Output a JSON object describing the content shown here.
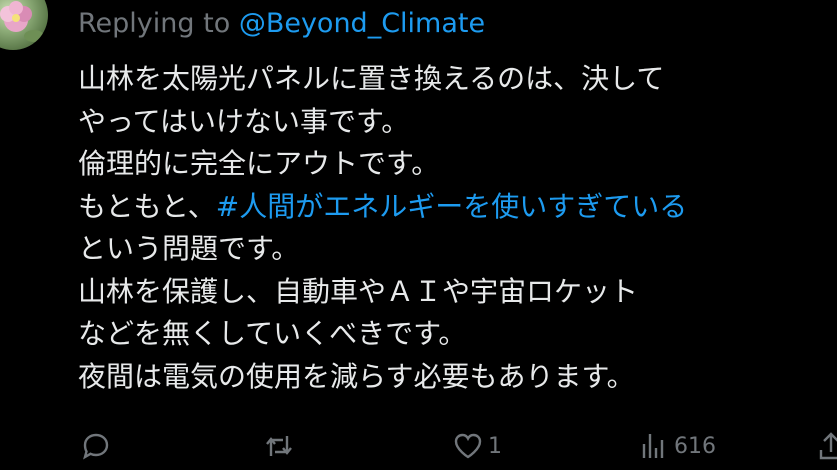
{
  "reply": {
    "prefix": "Replying to ",
    "handle": "@Beyond_Climate"
  },
  "tweet": {
    "line1": "山林を太陽光パネルに置き換えるのは、決して",
    "line2": "やってはいけない事です。",
    "line3": "倫理的に完全にアウトです。",
    "line4_prefix": "もともと、",
    "line4_hashtag": "#人間がエネルギーを使いすぎている",
    "line5": "という問題です。",
    "line6": "山林を保護し、自動車やＡＩや宇宙ロケット",
    "line7": "などを無くしていくべきです。",
    "line8": "夜間は電気の使用を減らす必要もあります。"
  },
  "actions": {
    "reply_icon": "reply-icon",
    "retweet_icon": "retweet-icon",
    "like_icon": "heart-icon",
    "like_count": "1",
    "views_icon": "views-icon",
    "views_count": "616",
    "share_icon": "share-icon"
  },
  "colors": {
    "background": "#000000",
    "text": "#e7e9ea",
    "muted": "#71767b",
    "link": "#1d9bf0"
  }
}
